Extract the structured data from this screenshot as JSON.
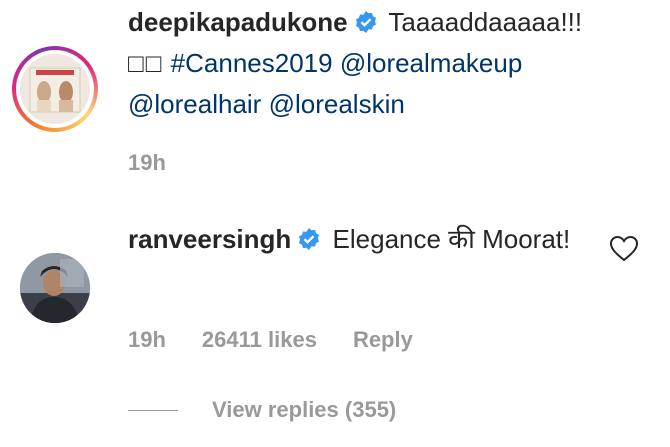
{
  "comment1": {
    "username": "deepikapadukone",
    "text_start": "Taaaaddaaaaa!!!",
    "emoji_placeholder": "□□",
    "hashtag": "#Cannes2019",
    "mention1": "@lorealmakeup",
    "mention2": "@lorealhair",
    "mention3": "@lorealskin",
    "time": "19h"
  },
  "comment2": {
    "username": "ranveersingh",
    "text": "Elegance की Moorat!",
    "time": "19h",
    "likes": "26411 likes",
    "reply_label": "Reply"
  },
  "view_replies": "View replies (355)",
  "colors": {
    "link": "#003569",
    "muted": "#999999",
    "verified": "#3897f0"
  },
  "icons": [
    "verified-badge-icon",
    "heart-icon"
  ]
}
